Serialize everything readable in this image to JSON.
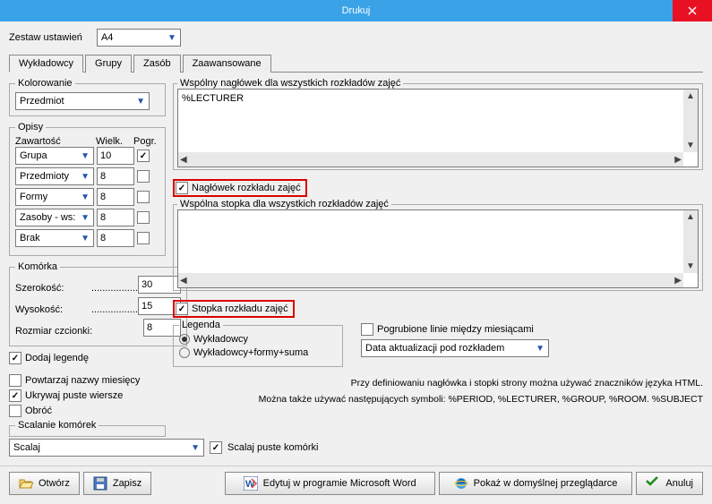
{
  "title": "Drukuj",
  "presets": {
    "label": "Zestaw ustawień",
    "value": "A4"
  },
  "tabs": [
    "Wykładowcy",
    "Grupy",
    "Zasób",
    "Zaawansowane"
  ],
  "activeTab": 0,
  "kolor": {
    "legend": "Kolorowanie",
    "value": "Przedmiot"
  },
  "opisy": {
    "legend": "Opisy",
    "headers": [
      "Zawartość",
      "Wielk.",
      "Pogr."
    ],
    "rows": [
      {
        "sel": "Grupa",
        "val": "10",
        "chk": true
      },
      {
        "sel": "Przedmioty",
        "val": "8",
        "chk": false
      },
      {
        "sel": "Formy",
        "val": "8",
        "chk": false
      },
      {
        "sel": "Zasoby - ws:",
        "val": "8",
        "chk": false
      },
      {
        "sel": "Brak",
        "val": "8",
        "chk": false
      }
    ]
  },
  "komorka": {
    "legend": "Komórka",
    "szer": {
      "label": "Szerokość:",
      "val": "30"
    },
    "wys": {
      "label": "Wysokość:",
      "val": "15"
    },
    "font": {
      "label": "Rozmiar czcionki:",
      "val": "8"
    }
  },
  "dodaj": {
    "label": "Dodaj legendę",
    "chk": true
  },
  "powt": {
    "label": "Powtarzaj nazwy miesięcy",
    "chk": false
  },
  "ukryj": {
    "label": "Ukrywaj puste wiersze",
    "chk": true
  },
  "obroc": {
    "label": "Obróć",
    "chk": false
  },
  "scalanie": {
    "legend": "Scalanie komórek",
    "value": "Scalaj",
    "puste": {
      "label": "Scalaj puste komórki",
      "chk": true
    }
  },
  "headerBlock": {
    "legend": "Wspólny nagłówek dla wszystkich rozkładów zajęć",
    "text": "%LECTURER"
  },
  "naglowek": {
    "label": "Nagłówek rozkładu zajęć",
    "chk": true
  },
  "footerBlock": {
    "legend": "Wspólna stopka dla wszystkich rozkładów zajęć",
    "text": ""
  },
  "stopka": {
    "label": "Stopka rozkładu zajęć",
    "chk": true
  },
  "legenda": {
    "legend": "Legenda",
    "r1": "Wykładowcy",
    "r2": "Wykładowcy+formy+suma",
    "sel": 0
  },
  "pogrub": {
    "label": "Pogrubione linie między miesiącami",
    "chk": false
  },
  "dataakt": {
    "value": "Data aktualizacji pod rozkładem"
  },
  "info1": "Przy definiowaniu nagłówka i stopki strony można używać znaczników języka HTML.",
  "info2": "Można także używać następujących symboli: %PERIOD, %LECTURER, %GROUP, %ROOM. %SUBJECT",
  "btns": {
    "open": "Otwórz",
    "save": "Zapisz",
    "word": "Edytuj w programie Microsoft Word",
    "ie": "Pokaż w domyślnej przeglądarce",
    "cancel": "Anuluj"
  }
}
